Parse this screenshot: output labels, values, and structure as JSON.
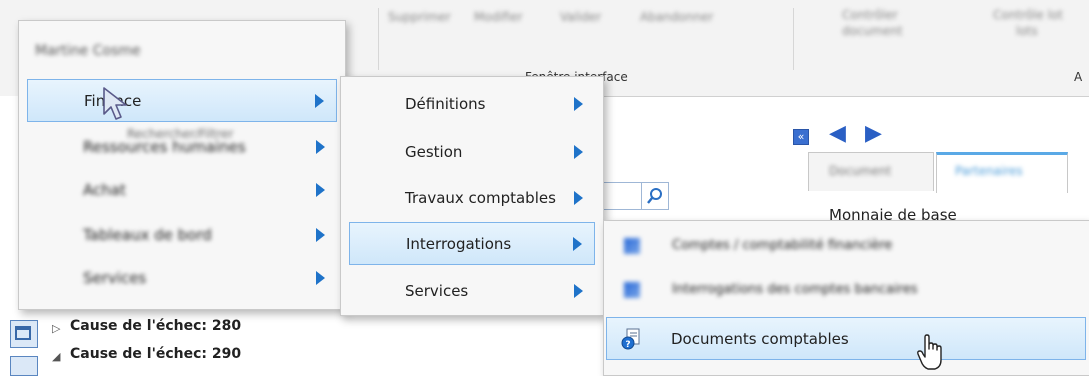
{
  "ribbon": {
    "group_label": "Fenêtre interface",
    "group_label_right": "A",
    "blurred": [
      "Supprimer",
      "Modifier",
      "Valider",
      "Abandonner",
      "Contrôler",
      "document",
      "Contrôle lot",
      "lots"
    ]
  },
  "pane": {
    "collapse_glyph": "«",
    "prev_glyph": "◀",
    "next_glyph": "▶",
    "tabs": [
      "Document",
      "Partenaires"
    ],
    "field_label": "Monnaie de base"
  },
  "tree": {
    "rows": [
      {
        "caret": "▷",
        "label": "Cause de l'échec: 280"
      },
      {
        "caret": "◢",
        "label": "Cause de l'échec: 290"
      }
    ]
  },
  "menu1": {
    "header": "Martine Cosme",
    "items": [
      {
        "label": "Finance",
        "selected": true
      },
      {
        "label": "Ressources humaines",
        "selected": false
      },
      {
        "label": "Achat",
        "selected": false
      },
      {
        "label": "Tableaux de bord",
        "selected": false
      },
      {
        "label": "Services",
        "selected": false
      }
    ],
    "overlay_blur": "Rechercher/Filtrer"
  },
  "menu2": {
    "items": [
      {
        "label": "Définitions",
        "selected": false
      },
      {
        "label": "Gestion",
        "selected": false
      },
      {
        "label": "Travaux comptables",
        "selected": false
      },
      {
        "label": "Interrogations",
        "selected": true
      },
      {
        "label": "Services",
        "selected": false
      }
    ]
  },
  "menu3": {
    "items": [
      {
        "label": "Comptes / comptabilité financière",
        "selected": false,
        "blurred": true
      },
      {
        "label": "Interrogations des comptes bancaires",
        "selected": false,
        "blurred": true
      },
      {
        "label": "Documents comptables",
        "selected": true,
        "blurred": false
      }
    ]
  },
  "colors": {
    "selection_fill": "#cfe7fa",
    "selection_border": "#7eb4ea",
    "arrow": "#1f73c9"
  }
}
